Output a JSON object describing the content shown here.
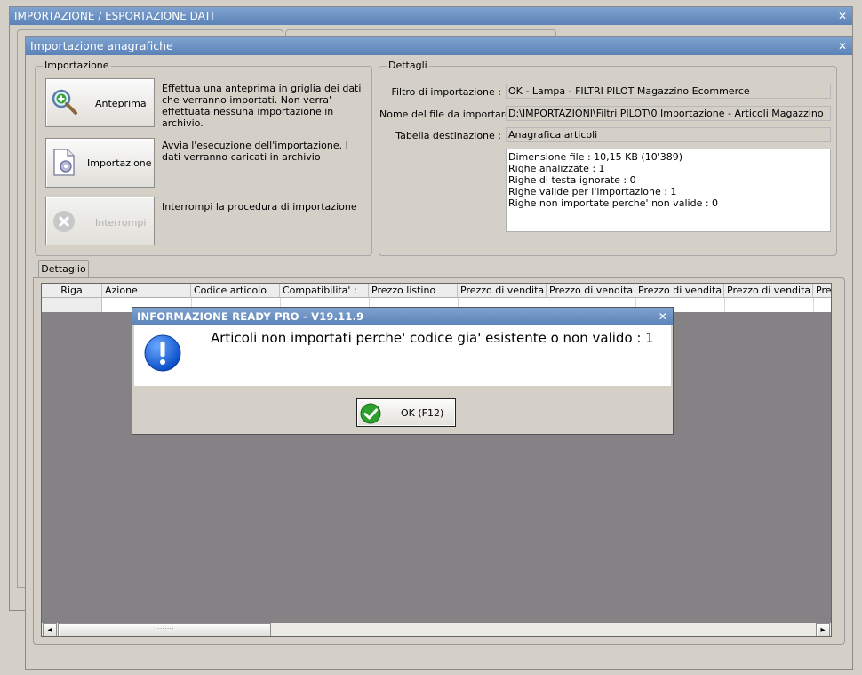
{
  "outer_window": {
    "title": "IMPORTAZIONE / ESPORTAZIONE DATI",
    "close": "✕"
  },
  "inner_window": {
    "title": "Importazione anagrafiche",
    "close": "✕"
  },
  "import_group": {
    "legend": "Importazione",
    "buttons": [
      {
        "label": "Anteprima",
        "icon": "magnifier-plus-icon",
        "description": "Effettua una anteprima in griglia dei dati che verranno importati. Non verra' effettuata nessuna importazione in archivio."
      },
      {
        "label": "Importazione",
        "icon": "document-gear-icon",
        "description": "Avvia l'esecuzione dell'importazione. I dati verranno caricati in archivio"
      },
      {
        "label": "Interrompi",
        "icon": "stop-cross-icon",
        "description": "Interrompi la procedura di importazione",
        "disabled": true
      }
    ]
  },
  "details_group": {
    "legend": "Dettagli",
    "filter_label": "Filtro di importazione :",
    "filter_value": "OK - Lampa - FILTRI PILOT Magazzino Ecommerce",
    "file_label": "Nome del file da importare :",
    "file_value": "D:\\IMPORTAZIONI\\Filtri PILOT\\0 Importazione - Articoli Magazzino",
    "table_label": "Tabella destinazione :",
    "table_value": "Anagrafica articoli",
    "summary_lines": [
      "Dimensione file : 10,15 KB (10'389)",
      "Righe analizzate : 1",
      "Righe di testa ignorate : 0",
      "Righe valide per l'importazione : 1",
      "Righe non importate perche' non valide : 0"
    ]
  },
  "tab": {
    "label": "Dettaglio"
  },
  "grid": {
    "columns": [
      "Riga",
      "Azione",
      "Codice articolo",
      "Compatibilita' :",
      "Prezzo listino",
      "Prezzo di vendita",
      "Prezzo di vendita",
      "Prezzo di vendita",
      "Prezzo di vendita",
      "Prez"
    ]
  },
  "dialog": {
    "title": "INFORMAZIONE READY PRO - V19.11.9",
    "close": "✕",
    "message": "Articoli non importati perche' codice gia' esistente o non valido : 1",
    "ok_label": "OK (F12)"
  },
  "scrollbar": {
    "left_arrow": "◂",
    "right_arrow": "▸",
    "grip": "::::::::"
  },
  "colors": {
    "titlebar": "#5b82b8",
    "grid_bg": "#858285",
    "window_bg": "#d4d0c8"
  }
}
